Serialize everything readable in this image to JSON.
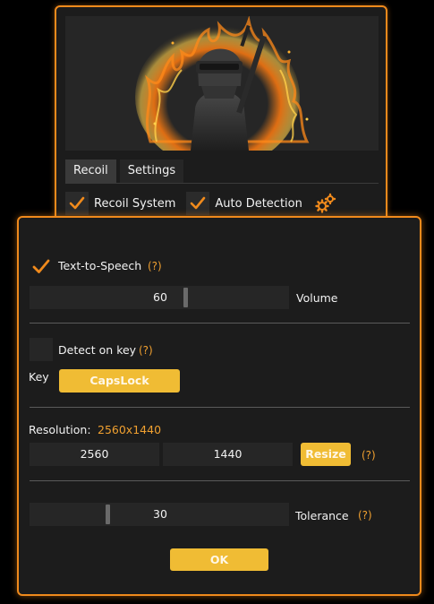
{
  "colors": {
    "accent": "#f08a1c",
    "button": "#f0bc34",
    "panel": "#1c1c1c",
    "field": "#262626"
  },
  "back_window": {
    "banner": {
      "icon": "soldier-flames-artwork"
    },
    "tabs": [
      {
        "label": "Recoil",
        "active": true
      },
      {
        "label": "Settings",
        "active": false
      }
    ],
    "recoil_system": {
      "label": "Recoil System",
      "checked": true
    },
    "auto_detection": {
      "label": "Auto Detection",
      "checked": true
    },
    "settings_icon": "gears-icon"
  },
  "dialog": {
    "tts": {
      "label": "Text-to-Speech",
      "checked": true,
      "help": "(?)"
    },
    "volume": {
      "value": "60",
      "label": "Volume"
    },
    "detect_on_key": {
      "label": "Detect on key",
      "checked": false,
      "help": "(?)"
    },
    "key": {
      "label": "Key",
      "value": "CapsLock"
    },
    "resolution": {
      "label": "Resolution:",
      "current": "2560x1440",
      "width": "2560",
      "height": "1440",
      "resize_label": "Resize",
      "help": "(?)"
    },
    "tolerance": {
      "value": "30",
      "label": "Tolerance",
      "help": "(?)"
    },
    "ok_label": "OK"
  }
}
